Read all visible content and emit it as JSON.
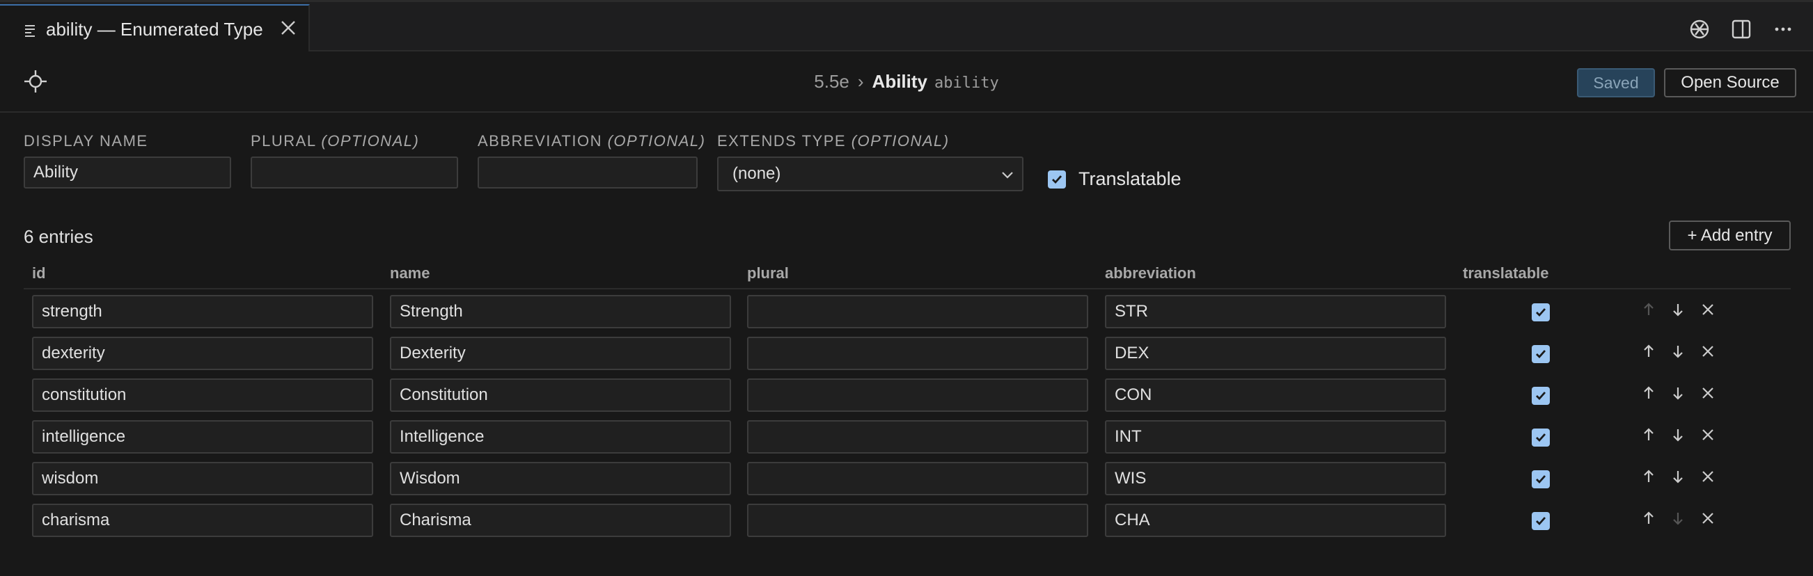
{
  "tab": {
    "title": "ability — Enumerated Type"
  },
  "header": {
    "breadcrumb_root": "5.5e",
    "breadcrumb_sep": "›",
    "title": "Ability",
    "code_id": "ability",
    "saved_label": "Saved",
    "open_source_label": "Open Source"
  },
  "form": {
    "display_name": {
      "label": "DISPLAY NAME",
      "value": "Ability"
    },
    "plural": {
      "label": "PLURAL",
      "optional": "(OPTIONAL)",
      "value": ""
    },
    "abbreviation": {
      "label": "ABBREVIATION",
      "optional": "(OPTIONAL)",
      "value": ""
    },
    "extends_type": {
      "label": "EXTENDS TYPE",
      "optional": "(OPTIONAL)",
      "value": "(none)"
    },
    "translatable": {
      "label": "Translatable",
      "checked": true
    }
  },
  "entries": {
    "count_label": "6 entries",
    "add_label": "+ Add entry",
    "columns": [
      "id",
      "name",
      "plural",
      "abbreviation",
      "translatable"
    ],
    "rows": [
      {
        "id": "strength",
        "name": "Strength",
        "plural": "",
        "abbreviation": "STR",
        "translatable": true
      },
      {
        "id": "dexterity",
        "name": "Dexterity",
        "plural": "",
        "abbreviation": "DEX",
        "translatable": true
      },
      {
        "id": "constitution",
        "name": "Constitution",
        "plural": "",
        "abbreviation": "CON",
        "translatable": true
      },
      {
        "id": "intelligence",
        "name": "Intelligence",
        "plural": "",
        "abbreviation": "INT",
        "translatable": true
      },
      {
        "id": "wisdom",
        "name": "Wisdom",
        "plural": "",
        "abbreviation": "WIS",
        "translatable": true
      },
      {
        "id": "charisma",
        "name": "Charisma",
        "plural": "",
        "abbreviation": "CHA",
        "translatable": true
      }
    ]
  },
  "icons": [
    "list-icon",
    "close-icon",
    "openai-icon",
    "split-editor-icon",
    "more-icon",
    "target-icon",
    "chevron-down-icon",
    "arrow-up-icon",
    "arrow-down-icon"
  ],
  "colors": {
    "accent": "#3c6fa8",
    "checkbox": "#9cc6f2",
    "saved_bg": "#27435a"
  }
}
